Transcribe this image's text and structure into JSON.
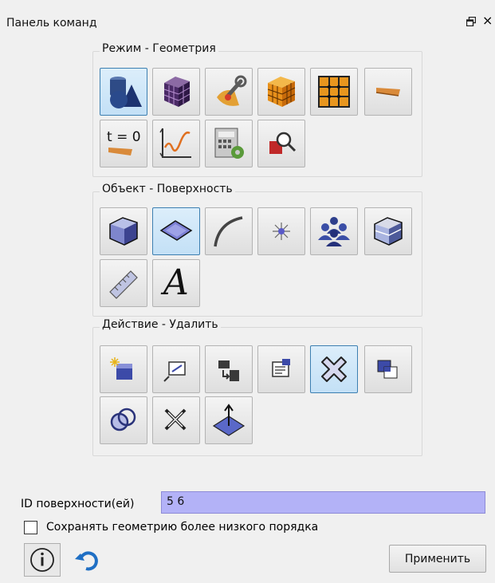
{
  "panel": {
    "title": "Панель команд",
    "float_icon": "float-icon",
    "close_glyph": "×"
  },
  "groups": {
    "mode": {
      "label": "Режим - Геометрия",
      "buttons": [
        {
          "name": "geometry-mode-button",
          "icon": "geometry-shapes-icon",
          "active": true
        },
        {
          "name": "mesh-mode-button",
          "icon": "mesh-cube-icon",
          "active": false
        },
        {
          "name": "tools-mode-button",
          "icon": "wrench-tools-icon",
          "active": false
        },
        {
          "name": "volume-mesh-mode-button",
          "icon": "orange-cube-grid-icon",
          "active": false
        },
        {
          "name": "grid-mode-button",
          "icon": "orange-grid-icon",
          "active": false
        },
        {
          "name": "material-mode-button",
          "icon": "material-strip-icon",
          "active": false
        },
        {
          "name": "initial-condition-mode-button",
          "icon": "t-zero-icon",
          "active": false
        },
        {
          "name": "plot-mode-button",
          "icon": "line-chart-icon",
          "active": false
        },
        {
          "name": "calculator-mode-button",
          "icon": "calculator-gear-icon",
          "active": false
        },
        {
          "name": "inspect-mode-button",
          "icon": "magnifier-shapes-icon",
          "active": false
        }
      ]
    },
    "object": {
      "label": "Объект - Поверхность",
      "buttons": [
        {
          "name": "volume-object-button",
          "icon": "volume-cube-icon",
          "active": false
        },
        {
          "name": "surface-object-button",
          "icon": "surface-icon",
          "active": true
        },
        {
          "name": "curve-object-button",
          "icon": "curve-icon",
          "active": false
        },
        {
          "name": "vertex-object-button",
          "icon": "vertex-star-icon",
          "active": false
        },
        {
          "name": "group-object-button",
          "icon": "people-group-icon",
          "active": false
        },
        {
          "name": "body-object-button",
          "icon": "body-cube-icon",
          "active": false
        },
        {
          "name": "measure-object-button",
          "icon": "ruler-icon",
          "active": false
        },
        {
          "name": "text-object-button",
          "icon": "text-a-icon",
          "text": "A",
          "active": false
        }
      ]
    },
    "action": {
      "label": "Действие - Удалить",
      "buttons": [
        {
          "name": "create-action-button",
          "icon": "create-spark-icon",
          "active": false
        },
        {
          "name": "modify-action-button",
          "icon": "modify-icon",
          "active": false
        },
        {
          "name": "transform-action-button",
          "icon": "transform-icon",
          "active": false
        },
        {
          "name": "properties-action-button",
          "icon": "properties-icon",
          "active": false
        },
        {
          "name": "delete-action-button",
          "icon": "delete-cross-icon",
          "active": true
        },
        {
          "name": "copy-action-button",
          "icon": "copy-icon",
          "active": false
        },
        {
          "name": "boolean-action-button",
          "icon": "boolean-circles-icon",
          "active": false
        },
        {
          "name": "cut-action-button",
          "icon": "scissors-icon",
          "active": false
        },
        {
          "name": "normal-action-button",
          "icon": "normal-arrow-icon",
          "active": false
        }
      ]
    }
  },
  "form": {
    "id_label": "ID поверхности(ей)",
    "id_value": "5 6",
    "checkbox_label": "Сохранять геометрию более низкого порядка",
    "checkbox_checked": false
  },
  "footer": {
    "info_icon": "info-icon",
    "undo_icon": "undo-icon",
    "apply_label": "Применить"
  },
  "colors": {
    "active_border": "#3c7fb1",
    "active_fill": "#c3e0f6",
    "input_fill": "#b3b2f7"
  }
}
